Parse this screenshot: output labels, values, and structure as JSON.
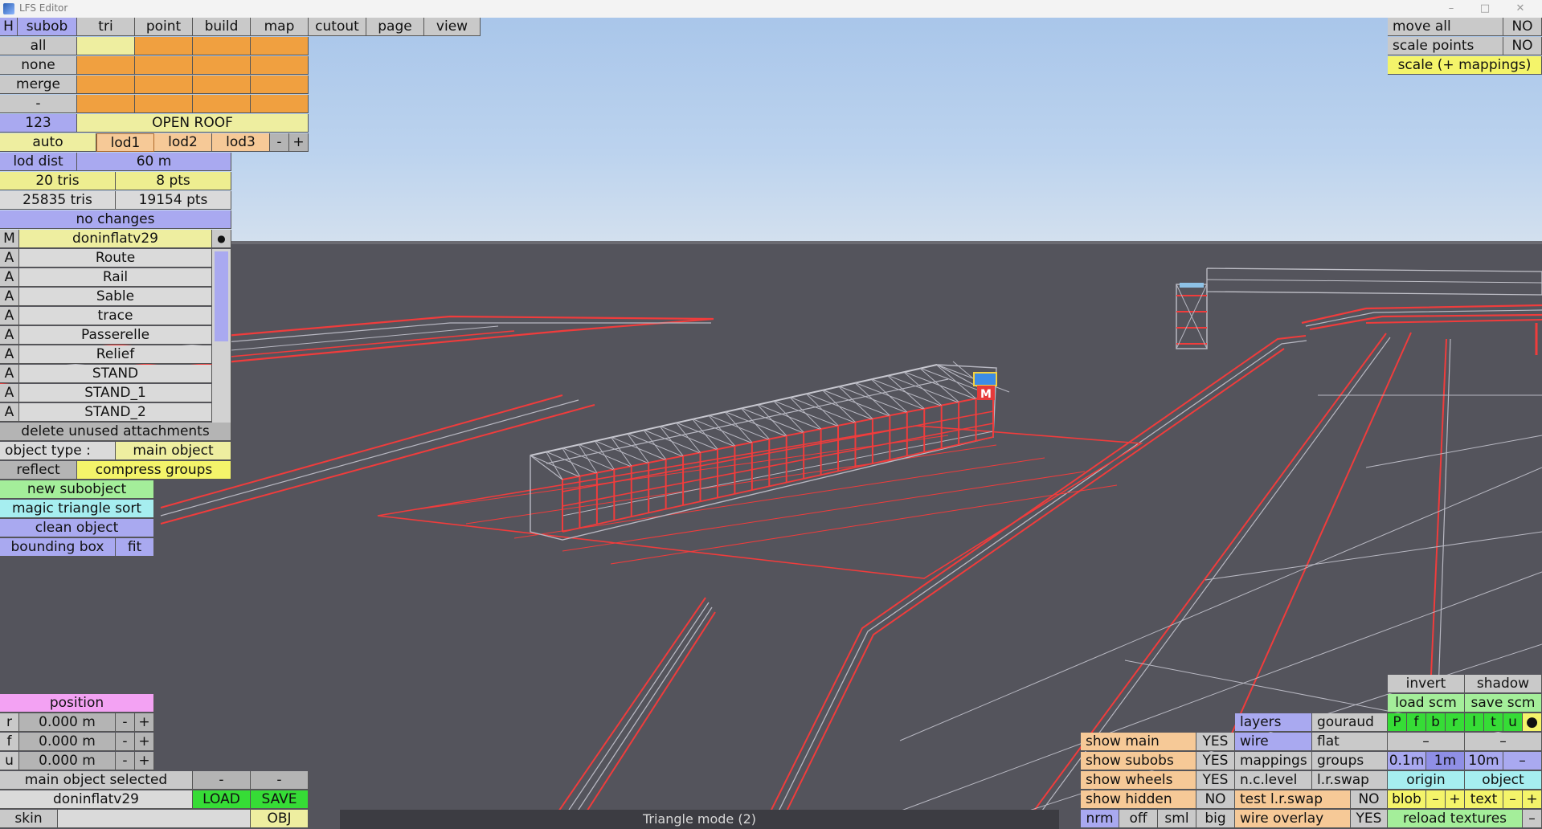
{
  "window": {
    "title": "LFS Editor",
    "buttons": [
      "–",
      "□",
      "✕"
    ]
  },
  "menu": {
    "h": "H",
    "tabs": [
      "subob",
      "tri",
      "point",
      "build",
      "map",
      "cutout",
      "page",
      "view"
    ]
  },
  "left": {
    "sel": [
      "all",
      "none",
      "merge",
      "-"
    ],
    "sub_number": "123",
    "sub_name": "OPEN ROOF",
    "lod": [
      "auto",
      "lod1",
      "lod2",
      "lod3",
      "-",
      "+"
    ],
    "lod_dist_label": "lod dist",
    "lod_dist_value": "60 m",
    "tris": "20 tris",
    "pts": "8 pts",
    "total_tris": "25835 tris",
    "total_pts": "19154 pts",
    "changes": "no changes",
    "main_prefix": "M",
    "main_name": "doninflatv29",
    "main_dot": "●",
    "attach_prefix": "A",
    "attachments": [
      "Route",
      "Rail",
      "Sable",
      "trace",
      "Passerelle",
      "Relief",
      "STAND",
      "STAND_1",
      "STAND_2"
    ],
    "delete_unused": "delete unused attachments",
    "object_type_label": "object type :",
    "object_type_value": "main object",
    "reflect": "reflect",
    "compress": "compress groups",
    "new_subobject": "new subobject",
    "magic_sort": "magic triangle sort",
    "clean": "clean object",
    "bbox": "bounding box",
    "fit": "fit"
  },
  "position": {
    "title": "position",
    "rows": [
      {
        "axis": "r",
        "value": "0.000 m"
      },
      {
        "axis": "f",
        "value": "0.000 m"
      },
      {
        "axis": "u",
        "value": "0.000 m"
      }
    ],
    "minus": "-",
    "plus": "+"
  },
  "bottom_left": {
    "selected": "main object selected",
    "minus": "-",
    "file": "doninflatv29",
    "load": "LOAD",
    "save": "SAVE",
    "skin": "skin",
    "obj": "OBJ"
  },
  "top_right": {
    "move_all": "move all",
    "move_all_val": "NO",
    "scale_points": "scale points",
    "scale_points_val": "NO",
    "scale_mappings": "scale (+ mappings)"
  },
  "bottom_right": {
    "show": [
      {
        "label": "show main",
        "value": "YES"
      },
      {
        "label": "show subobs",
        "value": "YES"
      },
      {
        "label": "show wheels",
        "value": "YES"
      },
      {
        "label": "show hidden",
        "value": "NO"
      }
    ],
    "view_modes": [
      "nrm",
      "off",
      "sml",
      "big"
    ],
    "layers": "layers",
    "gouraud": "gouraud",
    "wire": "wire",
    "flat": "flat",
    "mappings": "mappings",
    "groups": "groups",
    "nclevel": "n.c.level",
    "lrswap": "l.r.swap",
    "test_lrswap": "test l.r.swap",
    "test_lrswap_val": "NO",
    "wire_overlay": "wire overlay",
    "wire_overlay_val": "YES",
    "invert": "invert",
    "shadow": "shadow",
    "load_scm": "load scm",
    "save_scm": "save scm",
    "views": [
      "P",
      "f",
      "b",
      "r",
      "l",
      "t",
      "u",
      "●"
    ],
    "dash": "–",
    "grid": [
      "0.1m",
      "1m",
      "10m",
      "–"
    ],
    "origin": "origin",
    "object": "object",
    "blob": "blob",
    "text": "text",
    "minus": "–",
    "plus": "+",
    "reload": "reload textures",
    "reload_minus": "–"
  },
  "status": "Triangle mode (2)",
  "scene_labels": {
    "marker": "M"
  },
  "colors": {
    "wire_red": "#f03c3c",
    "wire_grey": "#b8b8c2",
    "ground": "#54545c"
  }
}
